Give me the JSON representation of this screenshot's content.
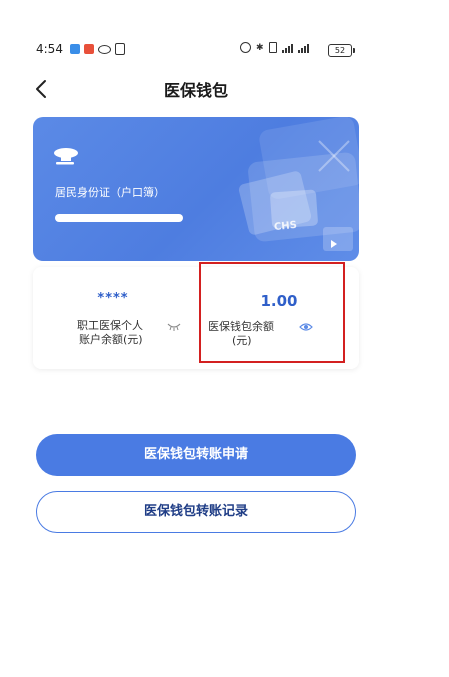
{
  "status_bar": {
    "time": "4:54",
    "battery": "52"
  },
  "header": {
    "title": "医保钱包",
    "back_icon": "chevron-left-icon"
  },
  "id_card": {
    "id_type": "居民身份证（户口簿）",
    "number_masked": true,
    "logo_text": "CHS"
  },
  "balances": {
    "personal_account": {
      "value": "****",
      "label_line1": "职工医保个人",
      "label_line2": "账户余额(元)",
      "visibility_icon": "eye-closed-icon"
    },
    "wallet": {
      "value": "1.00",
      "label_line1": "医保钱包余额",
      "label_line2": "(元)",
      "visibility_icon": "eye-open-icon"
    }
  },
  "actions": {
    "apply_label": "医保钱包转账申请",
    "record_label": "医保钱包转账记录"
  },
  "colors": {
    "primary": "#4a7be3",
    "value_text": "#2f5fc9",
    "highlight": "#d32020"
  }
}
